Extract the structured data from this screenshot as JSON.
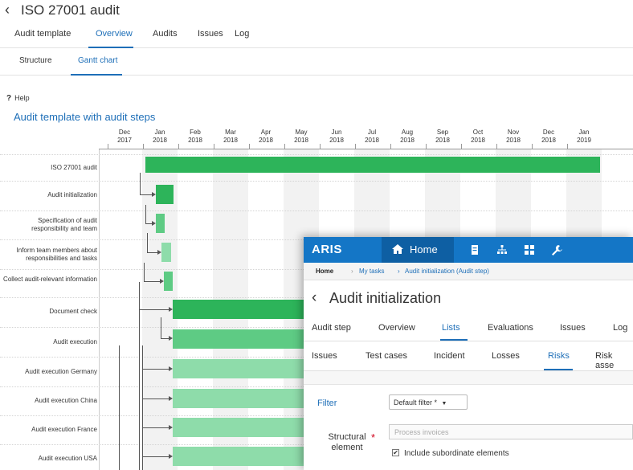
{
  "header": {
    "back_icon": "chevron-left-icon",
    "title": "ISO 27001 audit"
  },
  "main_tabs": [
    "Audit template",
    "Overview",
    "Audits",
    "Issues",
    "Log"
  ],
  "main_tabs_active": "Overview",
  "sub_tabs": [
    "Structure",
    "Gantt chart"
  ],
  "sub_tabs_active": "Gantt chart",
  "help": {
    "icon": "?",
    "label": "Help"
  },
  "section_title": "Audit template with audit steps",
  "gantt": {
    "months": [
      {
        "m": "Dec",
        "y": "2017"
      },
      {
        "m": "Jan",
        "y": "2018"
      },
      {
        "m": "Feb",
        "y": "2018"
      },
      {
        "m": "Mar",
        "y": "2018"
      },
      {
        "m": "Apr",
        "y": "2018"
      },
      {
        "m": "May",
        "y": "2018"
      },
      {
        "m": "Jun",
        "y": "2018"
      },
      {
        "m": "Jul",
        "y": "2018"
      },
      {
        "m": "Aug",
        "y": "2018"
      },
      {
        "m": "Sep",
        "y": "2018"
      },
      {
        "m": "Oct",
        "y": "2018"
      },
      {
        "m": "Nov",
        "y": "2018"
      },
      {
        "m": "Dec",
        "y": "2018"
      },
      {
        "m": "Jan",
        "y": "2019"
      }
    ],
    "rows": [
      "ISO 27001 audit",
      "Audit initialization",
      "Specification of audit responsibility and team",
      "Inform team members about responsibilities and tasks",
      "Collect audit-relevant information",
      "Document check",
      "Audit execution",
      "Audit execution Germany",
      "Audit execution China",
      "Audit execution France",
      "Audit execution USA"
    ],
    "colors": {
      "dark": "#2db45a",
      "mid": "#5ecb84",
      "light": "#8edcaa"
    }
  },
  "aris": {
    "logo": "ARIS",
    "home_label": "Home",
    "nav_icons": [
      "home-icon",
      "document-icon",
      "hierarchy-icon",
      "grid-icon",
      "wrench-icon"
    ],
    "breadcrumb": {
      "home": "Home",
      "items": [
        "My tasks",
        "Audit initialization (Audit step)"
      ]
    },
    "title": "Audit initialization",
    "tabs1": [
      "Audit step",
      "Overview",
      "Lists",
      "Evaluations",
      "Issues",
      "Log"
    ],
    "tabs1_active": "Lists",
    "tabs2": [
      "Issues",
      "Test cases",
      "Incident",
      "Losses",
      "Risks",
      "Risk asse"
    ],
    "tabs2_active": "Risks",
    "filter_label": "Filter",
    "filter_value": "Default filter *",
    "struct_label_1": "Structural",
    "struct_label_2": "element",
    "struct_placeholder": "Process invoices",
    "include_label": "Include subordinate elements",
    "accent": "#1476c6"
  }
}
